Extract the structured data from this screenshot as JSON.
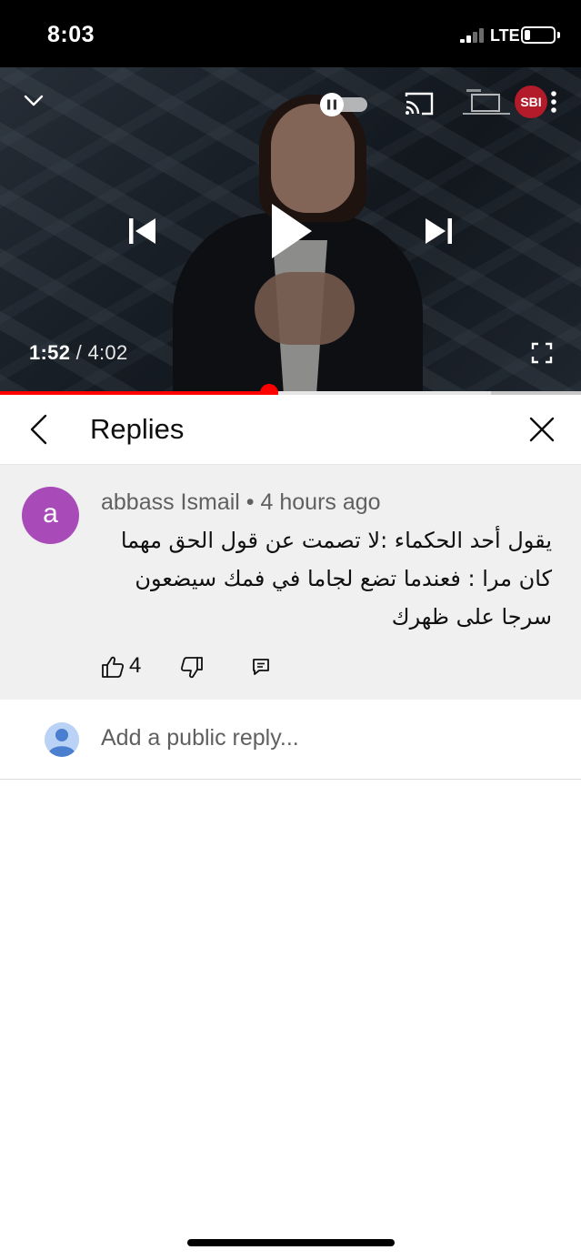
{
  "status_bar": {
    "time": "8:03",
    "network": "LTE",
    "signal_bars_filled": 2,
    "signal_bars_total": 4,
    "battery_level": 0.2
  },
  "player": {
    "current_time": "1:52",
    "separator": " / ",
    "duration": "4:02",
    "progress_fraction": 0.4628,
    "buffered_fraction": 0.845,
    "channel_logo_text": "SBI",
    "autoplay": "on",
    "colors": {
      "progress": "#ff0000",
      "overlay_icons": "#ffffff"
    },
    "icons": [
      "chevron-down-icon",
      "pause-icon",
      "cast-icon",
      "more-vert-icon",
      "skip-previous-icon",
      "play-icon",
      "skip-next-icon",
      "fullscreen-icon"
    ]
  },
  "replies_panel": {
    "title": "Replies",
    "icons": [
      "chevron-left-icon",
      "close-icon"
    ]
  },
  "comment": {
    "avatar_letter": "a",
    "avatar_color": "#a84bb9",
    "author": "abbass Ismail",
    "meta_separator": " • ",
    "time_ago": "4 hours ago",
    "text": "يقول أحد الحكماء :لا تصمت عن قول الحق مهما كان مرا : فعندما تضع لجاما في فمك سيضعون سرجا على ظهرك",
    "like_count": "4",
    "icons": [
      "thumbs-up-icon",
      "thumbs-down-icon",
      "reply-icon"
    ]
  },
  "add_reply": {
    "placeholder": "Add a public reply..."
  }
}
